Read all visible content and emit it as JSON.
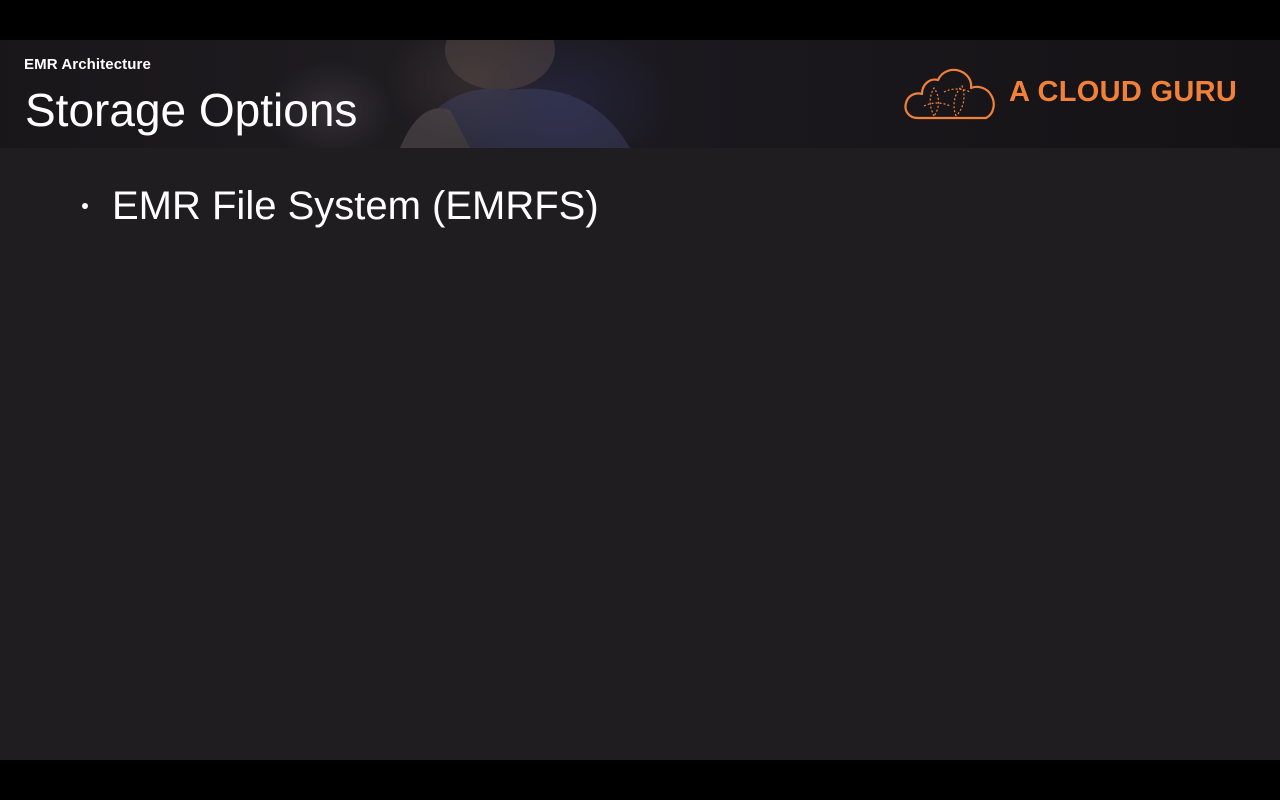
{
  "slide": {
    "subtitle": "EMR Architecture",
    "title": "Storage Options",
    "logo": {
      "text": "A CLOUD GURU",
      "icon": "cloud-icon",
      "color": "#f1813a"
    },
    "bullets": [
      {
        "text": "EMR File System (EMRFS)"
      }
    ]
  },
  "colors": {
    "slide_background": "#1f1d20",
    "letterbox": "#000000",
    "text": "#ffffff",
    "accent": "#f1813a"
  }
}
